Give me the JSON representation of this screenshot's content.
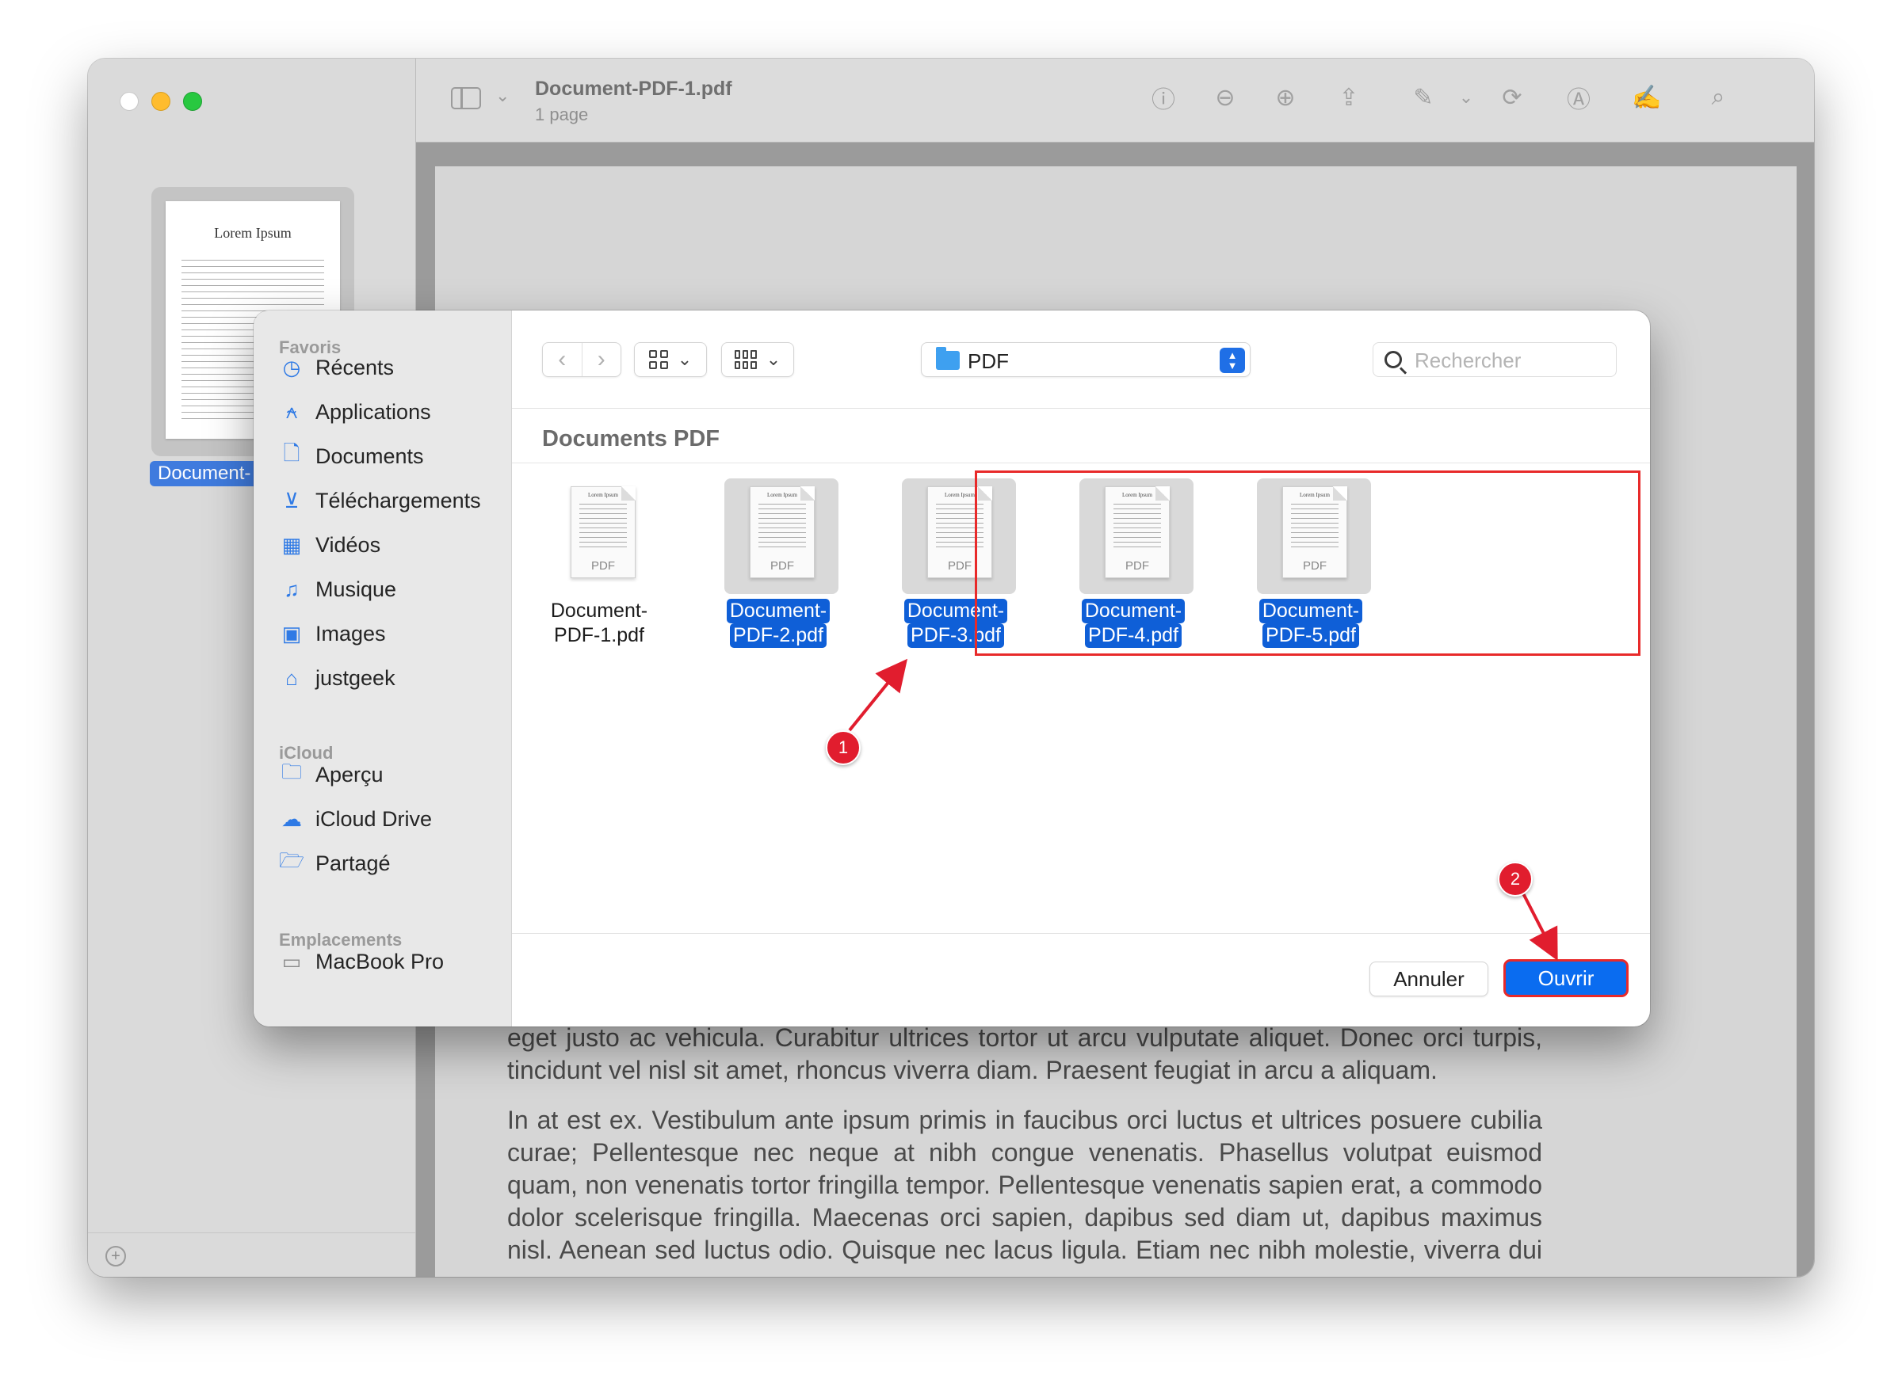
{
  "window": {
    "title": "Document-PDF-1.pdf",
    "subtitle": "1 page"
  },
  "preview_sidebar": {
    "thumbnail_title": "Lorem Ipsum",
    "thumbnail_label": "Document-"
  },
  "toolbar_icons": [
    "info-icon",
    "zoom-out-icon",
    "zoom-in-icon",
    "share-icon",
    "markup-icon",
    "rotate-icon",
    "annotate-icon",
    "signature-icon",
    "search-icon"
  ],
  "document_text": {
    "paragraph1": "eget justo ac vehicula. Curabitur ultrices tortor ut arcu vulputate aliquet. Donec orci turpis, tincidunt vel nisl sit amet, rhoncus viverra diam. Praesent feugiat in arcu a aliquam.",
    "paragraph2": "In at est ex. Vestibulum ante ipsum primis in faucibus orci luctus et ultrices posuere cubilia curae; Pellentesque nec neque at nibh congue venenatis. Phasellus volutpat euismod quam, non venenatis tortor fringilla tempor. Pellentesque venenatis sapien erat, a commodo dolor scelerisque fringilla. Maecenas orci sapien, dapibus sed diam ut, dapibus maximus nisl. Aenean sed luctus odio. Quisque nec lacus ligula. Etiam nec nibh molestie, viverra dui eu,"
  },
  "dialog": {
    "sections": {
      "favorites": "Favoris",
      "icloud": "iCloud",
      "locations": "Emplacements"
    },
    "favorites": [
      {
        "label": "Récents",
        "icon": "clock-icon"
      },
      {
        "label": "Applications",
        "icon": "applications-icon"
      },
      {
        "label": "Documents",
        "icon": "document-icon"
      },
      {
        "label": "Téléchargements",
        "icon": "download-icon"
      },
      {
        "label": "Vidéos",
        "icon": "film-icon"
      },
      {
        "label": "Musique",
        "icon": "music-note-icon"
      },
      {
        "label": "Images",
        "icon": "photo-icon"
      },
      {
        "label": "justgeek",
        "icon": "home-icon"
      }
    ],
    "icloud": [
      {
        "label": "Aperçu",
        "icon": "folder-icon"
      },
      {
        "label": "iCloud Drive",
        "icon": "cloud-icon"
      },
      {
        "label": "Partagé",
        "icon": "shared-folder-icon"
      }
    ],
    "locations": [
      {
        "label": "MacBook Pro",
        "icon": "laptop-icon"
      }
    ],
    "location": "PDF",
    "search_placeholder": "Rechercher",
    "folder_title": "Documents PDF",
    "files": [
      {
        "line1": "Document-",
        "line2": "PDF-1.pdf",
        "type": "PDF",
        "selected": false
      },
      {
        "line1": "Document-",
        "line2": "PDF-2.pdf",
        "type": "PDF",
        "selected": true
      },
      {
        "line1": "Document-",
        "line2": "PDF-3.pdf",
        "type": "PDF",
        "selected": true
      },
      {
        "line1": "Document-",
        "line2": "PDF-4.pdf",
        "type": "PDF",
        "selected": true
      },
      {
        "line1": "Document-",
        "line2": "PDF-5.pdf",
        "type": "PDF",
        "selected": true
      }
    ],
    "doc_header": "Lorem Ipsum",
    "cancel_label": "Annuler",
    "open_label": "Ouvrir"
  },
  "annotations": {
    "badge1": "1",
    "badge2": "2",
    "highlight_color": "#e82a2a"
  }
}
